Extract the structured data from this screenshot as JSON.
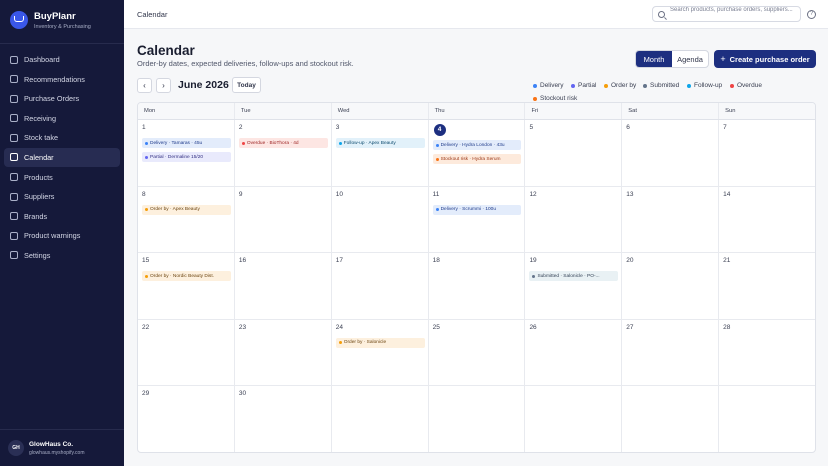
{
  "brand": {
    "name": "BuyPlanr",
    "subtitle": "Inventory & Purchasing"
  },
  "sidebar": {
    "items": [
      {
        "label": "Dashboard",
        "icon": "dashboard-icon"
      },
      {
        "label": "Recommendations",
        "icon": "recommendations-icon"
      },
      {
        "label": "Purchase Orders",
        "icon": "cart-icon"
      },
      {
        "label": "Receiving",
        "icon": "truck-icon"
      },
      {
        "label": "Stock take",
        "icon": "clipboard-icon"
      },
      {
        "label": "Calendar",
        "icon": "calendar-icon",
        "active": true
      },
      {
        "label": "Products",
        "icon": "box-icon"
      },
      {
        "label": "Suppliers",
        "icon": "suppliers-icon"
      },
      {
        "label": "Brands",
        "icon": "tag-icon"
      },
      {
        "label": "Product warnings",
        "icon": "warning-icon"
      },
      {
        "label": "Settings",
        "icon": "gear-icon"
      }
    ]
  },
  "account": {
    "initials": "GH",
    "name": "GlowHaus Co.",
    "domain": "glowhaus.myshopify.com"
  },
  "topbar": {
    "breadcrumb": "Calendar",
    "search_placeholder": "Search products, purchase orders, suppliers..."
  },
  "header": {
    "title": "Calendar",
    "subtitle": "Order-by dates, expected deliveries, follow-ups and stockout risk.",
    "view_month": "Month",
    "view_agenda": "Agenda",
    "create_label": "Create purchase order"
  },
  "controls": {
    "prev": "‹",
    "next": "›",
    "month": "June 2026",
    "today": "Today"
  },
  "legend": [
    {
      "label": "Delivery",
      "color": "#3b82f6"
    },
    {
      "label": "Partial",
      "color": "#6366f1"
    },
    {
      "label": "Order by",
      "color": "#f59e0b"
    },
    {
      "label": "Submitted",
      "color": "#64748b"
    },
    {
      "label": "Follow-up",
      "color": "#0ea5e9"
    },
    {
      "label": "Overdue",
      "color": "#ef4444"
    },
    {
      "label": "Stockout risk",
      "color": "#f97316"
    }
  ],
  "calendar": {
    "weekdays": [
      "Mon",
      "Tue",
      "Wed",
      "Thu",
      "Fri",
      "Sat",
      "Sun"
    ],
    "weeks": [
      [
        {
          "day": "1",
          "events": [
            {
              "text": "Delivery · Tamaras · 45u",
              "type": "delivery"
            },
            {
              "text": "Partial · Dermaline 15/20",
              "type": "partial"
            }
          ]
        },
        {
          "day": "2",
          "events": [
            {
              "text": "Overdue · BioThora · 4d",
              "type": "overdue"
            }
          ]
        },
        {
          "day": "3",
          "events": [
            {
              "text": "Follow-up · Apex Beauty",
              "type": "followup"
            }
          ]
        },
        {
          "day": "4",
          "today": true,
          "events": [
            {
              "text": "Delivery · Hydra London · 43u",
              "type": "delivery"
            },
            {
              "text": "Stockout risk · Hydra Serum",
              "type": "stockout"
            }
          ]
        },
        {
          "day": "5",
          "events": []
        },
        {
          "day": "6",
          "events": []
        },
        {
          "day": "7",
          "events": []
        }
      ],
      [
        {
          "day": "8",
          "events": [
            {
              "text": "Order by · Apex Beauty",
              "type": "orderby"
            }
          ]
        },
        {
          "day": "9",
          "events": []
        },
        {
          "day": "10",
          "events": []
        },
        {
          "day": "11",
          "events": [
            {
              "text": "Delivery · Scrummi · 100u",
              "type": "delivery"
            }
          ]
        },
        {
          "day": "12",
          "events": []
        },
        {
          "day": "13",
          "events": []
        },
        {
          "day": "14",
          "events": []
        }
      ],
      [
        {
          "day": "15",
          "events": [
            {
              "text": "Order by · Nordic Beauty Dist.",
              "type": "orderby"
            }
          ]
        },
        {
          "day": "16",
          "events": []
        },
        {
          "day": "17",
          "events": []
        },
        {
          "day": "18",
          "events": []
        },
        {
          "day": "19",
          "events": [
            {
              "text": "Submitted · Salonicle · PO-...",
              "type": "submitted"
            }
          ]
        },
        {
          "day": "20",
          "events": []
        },
        {
          "day": "21",
          "events": []
        }
      ],
      [
        {
          "day": "22",
          "events": []
        },
        {
          "day": "23",
          "events": []
        },
        {
          "day": "24",
          "events": [
            {
              "text": "Order by · Salonicle",
              "type": "orderby"
            }
          ]
        },
        {
          "day": "25",
          "events": []
        },
        {
          "day": "26",
          "events": []
        },
        {
          "day": "27",
          "events": []
        },
        {
          "day": "28",
          "events": []
        }
      ],
      [
        {
          "day": "29",
          "events": []
        },
        {
          "day": "30",
          "events": []
        },
        {
          "day": "",
          "events": []
        },
        {
          "day": "",
          "events": []
        },
        {
          "day": "",
          "events": []
        },
        {
          "day": "",
          "events": []
        },
        {
          "day": "",
          "events": []
        }
      ]
    ]
  },
  "event_styles": {
    "delivery": {
      "bg": "#e3ecfb",
      "dot": "#3b82f6",
      "text": "#1e3a8a"
    },
    "partial": {
      "bg": "#e9eafc",
      "dot": "#6366f1",
      "text": "#312e81"
    },
    "orderby": {
      "bg": "#fdf0de",
      "dot": "#f59e0b",
      "text": "#6b4410"
    },
    "submitted": {
      "bg": "#e9f1f4",
      "dot": "#64748b",
      "text": "#334155"
    },
    "followup": {
      "bg": "#e2f1fa",
      "dot": "#0ea5e9",
      "text": "#0c4a6e"
    },
    "overdue": {
      "bg": "#fde6e3",
      "dot": "#ef4444",
      "text": "#991b1b"
    },
    "stockout": {
      "bg": "#fdeadc",
      "dot": "#f97316",
      "text": "#9a3412"
    }
  }
}
